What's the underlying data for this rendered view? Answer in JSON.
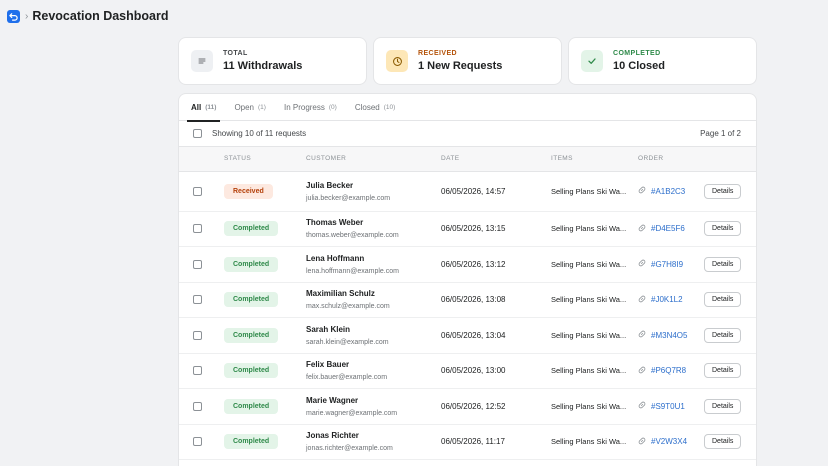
{
  "app": {
    "title": "Revocation Dashboard",
    "icon": "undo-arrow-icon",
    "accent": "#1f6feb"
  },
  "summary_cards": [
    {
      "label": "TOTAL",
      "value": "11 Withdrawals",
      "icon": "list-icon",
      "label_color": "#44474a",
      "icon_bg": "#eef0f3",
      "icon_color": "#6d7175"
    },
    {
      "label": "RECEIVED",
      "value": "1 New Requests",
      "icon": "clock-icon",
      "label_color": "#b4530a",
      "icon_bg": "#fde7b7",
      "icon_color": "#8a5a00"
    },
    {
      "label": "COMPLETED",
      "value": "10 Closed",
      "icon": "check-icon",
      "label_color": "#2f8a4a",
      "icon_bg": "#e3f4e8",
      "icon_color": "#2f8a4a"
    }
  ],
  "tabs": [
    {
      "label": "All",
      "count": "(11)",
      "active": true
    },
    {
      "label": "Open",
      "count": "(1)",
      "active": false
    },
    {
      "label": "In Progress",
      "count": "(0)",
      "active": false
    },
    {
      "label": "Closed",
      "count": "(10)",
      "active": false
    }
  ],
  "list_summary": {
    "showing": "Showing 10 of 11 requests",
    "page": "Page 1 of 2"
  },
  "table": {
    "headers": [
      "STATUS",
      "CUSTOMER",
      "DATE",
      "ITEMS",
      "ORDER"
    ],
    "details_label": "Details",
    "rows": [
      {
        "status": "Received",
        "name": "Julia Becker",
        "email": "julia.becker@example.com",
        "date": "06/05/2026, 14:57",
        "items": "Selling Plans Ski Wa...",
        "order": "#A1B2C3"
      },
      {
        "status": "Completed",
        "name": "Thomas Weber",
        "email": "thomas.weber@example.com",
        "date": "06/05/2026, 13:15",
        "items": "Selling Plans Ski Wa...",
        "order": "#D4E5F6"
      },
      {
        "status": "Completed",
        "name": "Lena Hoffmann",
        "email": "lena.hoffmann@example.com",
        "date": "06/05/2026, 13:12",
        "items": "Selling Plans Ski Wa...",
        "order": "#G7H8I9"
      },
      {
        "status": "Completed",
        "name": "Maximilian Schulz",
        "email": "max.schulz@example.com",
        "date": "06/05/2026, 13:08",
        "items": "Selling Plans Ski Wa...",
        "order": "#J0K1L2"
      },
      {
        "status": "Completed",
        "name": "Sarah Klein",
        "email": "sarah.klein@example.com",
        "date": "06/05/2026, 13:04",
        "items": "Selling Plans Ski Wa...",
        "order": "#M3N4O5"
      },
      {
        "status": "Completed",
        "name": "Felix Bauer",
        "email": "felix.bauer@example.com",
        "date": "06/05/2026, 13:00",
        "items": "Selling Plans Ski Wa...",
        "order": "#P6Q7R8"
      },
      {
        "status": "Completed",
        "name": "Marie Wagner",
        "email": "marie.wagner@example.com",
        "date": "06/05/2026, 12:52",
        "items": "Selling Plans Ski Wa...",
        "order": "#S9T0U1"
      },
      {
        "status": "Completed",
        "name": "Jonas Richter",
        "email": "jonas.richter@example.com",
        "date": "06/05/2026, 11:17",
        "items": "Selling Plans Ski Wa...",
        "order": "#V2W3X4"
      }
    ]
  },
  "status_colors": {
    "Received": {
      "bg": "#fde9e0",
      "fg": "#b4400a"
    },
    "Completed": {
      "bg": "#e3f4e8",
      "fg": "#2f8a4a"
    }
  }
}
